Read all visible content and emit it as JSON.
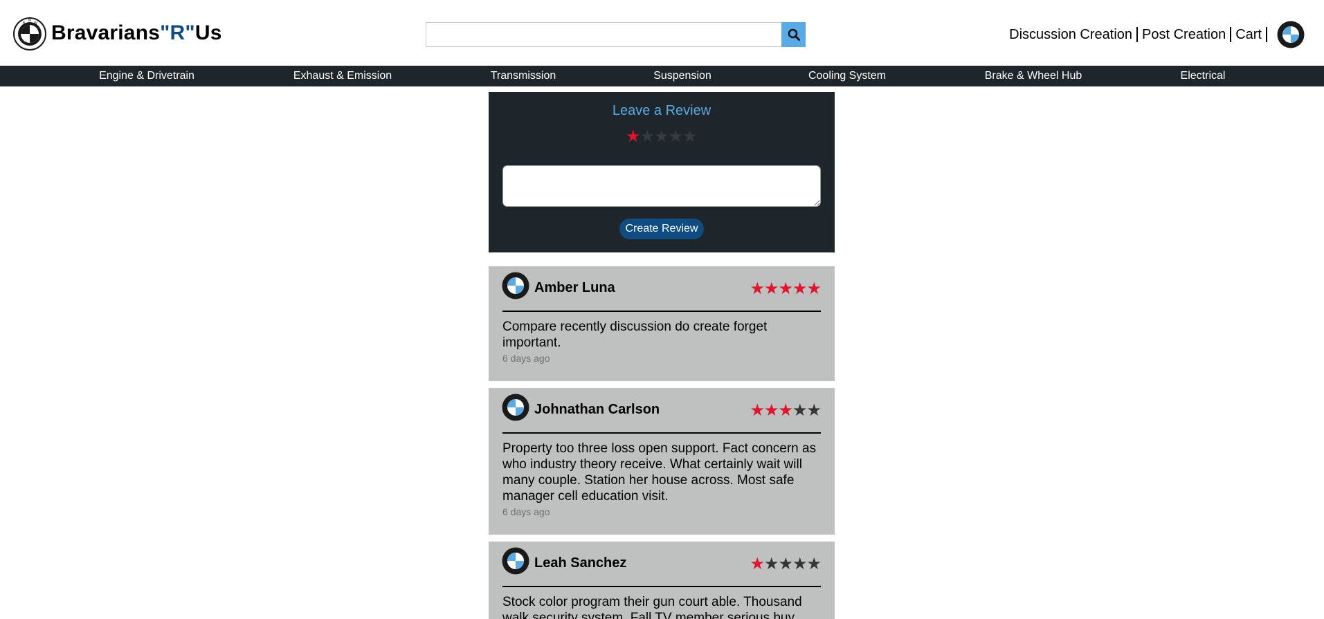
{
  "brand": {
    "prefix": "Bravarians",
    "accent": "\"R\"",
    "suffix": "Us"
  },
  "search": {
    "value": "",
    "placeholder": "",
    "button_icon": "search-icon"
  },
  "top_links": [
    {
      "label": "Discussion Creation"
    },
    {
      "label": "Post Creation"
    },
    {
      "label": "Cart"
    }
  ],
  "categories": [
    {
      "label": "Engine & Drivetrain"
    },
    {
      "label": "Exhaust & Emission"
    },
    {
      "label": "Transmission"
    },
    {
      "label": "Suspension"
    },
    {
      "label": "Cooling System"
    },
    {
      "label": "Brake & Wheel Hub"
    },
    {
      "label": "Electrical"
    }
  ],
  "review_form": {
    "title": "Leave a Review",
    "selected_rating": 1,
    "max_rating": 5,
    "textarea_value": "",
    "submit_label": "Create Review"
  },
  "reviews": [
    {
      "name": "Amber Luna",
      "rating": 5,
      "text": "Compare recently discussion do create forget important.",
      "time": "6 days ago"
    },
    {
      "name": "Johnathan Carlson",
      "rating": 3,
      "text": "Property too three loss open support. Fact concern as who industry theory receive. What certainly wait will many couple. Station her house across. Most safe manager cell education visit.",
      "time": "6 days ago"
    },
    {
      "name": "Leah Sanchez",
      "rating": 1,
      "text": "Stock color program their gun court able. Thousand walk security system. Fall TV member serious buy.",
      "time": ""
    }
  ],
  "colors": {
    "dark_bar": "#1e252b",
    "accent_blue": "#0f4c81",
    "light_blue": "#5aaae6",
    "star_on": "#e0142c",
    "star_off": "#353535",
    "card_bg": "#bfc0c0"
  },
  "icons": {
    "logo": "bmw-logo-icon",
    "avatar": "bmw-avatar-icon",
    "star": "star-icon"
  }
}
